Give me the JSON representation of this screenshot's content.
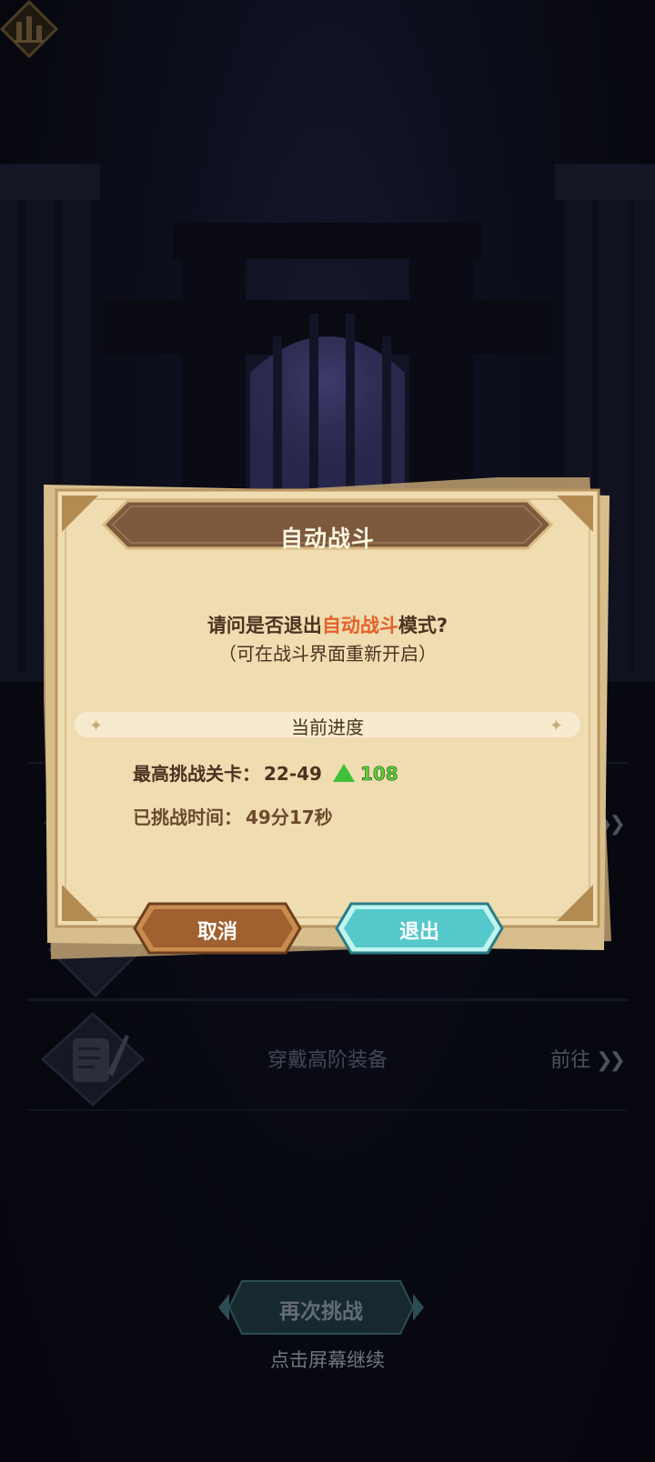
{
  "dialog": {
    "title": "自动战斗",
    "question_prefix": "请问是否退出",
    "question_highlight": "自动战斗",
    "question_suffix": "模式?",
    "hint": "（可在战斗界面重新开启）",
    "section_title": "当前进度",
    "highest_stage_label": "最高挑战关卡：",
    "highest_stage_value": "22-49",
    "stage_gain": "108",
    "elapsed_label": "已挑战时间：",
    "elapsed_value": "49分17秒",
    "cancel_label": "取消",
    "exit_label": "退出"
  },
  "background": {
    "row_partial_label": "",
    "equip_row_label": "穿戴高阶装备",
    "equip_row_action": "前往",
    "retry_label": "再次挑战",
    "continue_hint": "点击屏幕继续"
  },
  "icons": {
    "gain_arrow": "green-up-triangle-icon",
    "scroll": "scroll-quill-icon",
    "stats": "bar-chart-icon",
    "forward": "double-chevron-right-icon"
  },
  "colors": {
    "highlight": "#e4612a",
    "gain": "#5ad03a",
    "parchment": "#efdcb0",
    "cancel_button": "#a06030",
    "exit_button": "#5fd0cf"
  }
}
